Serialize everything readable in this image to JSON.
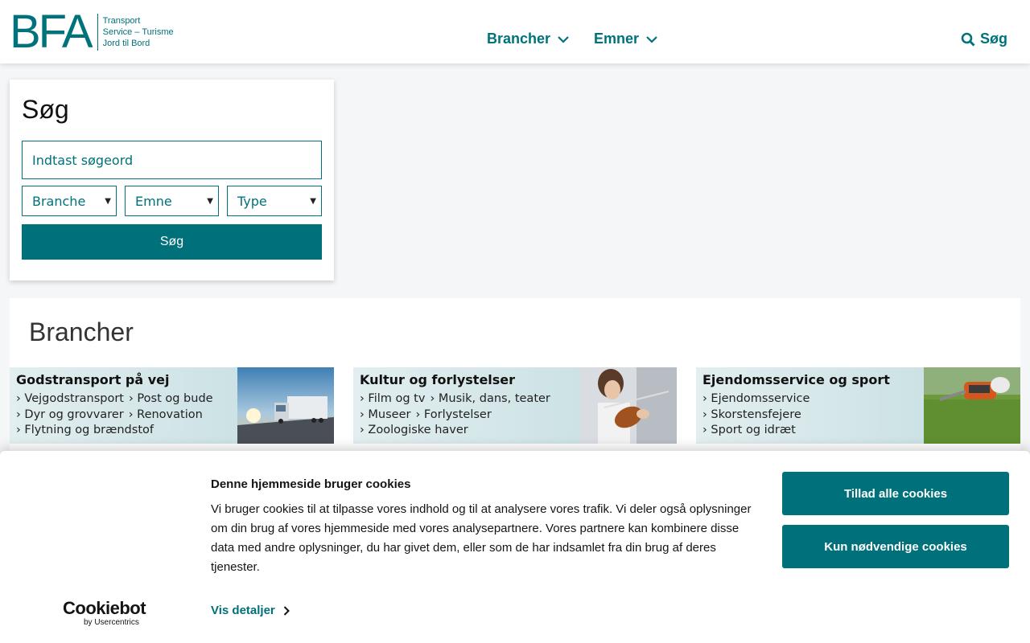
{
  "header": {
    "logo": {
      "mark": "BFA",
      "lines": [
        "Transport",
        "Service – Turisme",
        "Jord til Bord"
      ]
    },
    "nav": [
      {
        "label": "Brancher"
      },
      {
        "label": "Emner"
      }
    ],
    "search_label": "Søg"
  },
  "search_panel": {
    "title": "Søg",
    "input_placeholder": "Indtast søgeord",
    "filters": [
      {
        "label": "Branche"
      },
      {
        "label": "Emne"
      },
      {
        "label": "Type"
      }
    ],
    "button_label": "Søg"
  },
  "brancher": {
    "title": "Brancher",
    "cards": [
      {
        "title": "Godstransport på vej",
        "rows": [
          [
            "Vejgodstransport",
            "Post og bude"
          ],
          [
            "Dyr og grovvarer",
            "Renovation"
          ],
          [
            "Flytning og brændstof"
          ]
        ]
      },
      {
        "title": "Kultur og forlystelser",
        "rows": [
          [
            "Film og tv",
            "Musik, dans, teater"
          ],
          [
            "Museer",
            "Forlystelser"
          ],
          [
            "Zoologiske haver"
          ]
        ]
      },
      {
        "title": "Ejendomsservice og sport",
        "rows": [
          [
            "Ejendomsservice"
          ],
          [
            "Skorstensfejere"
          ],
          [
            "Sport og idræt"
          ]
        ]
      }
    ]
  },
  "cookie_banner": {
    "title": "Denne hjemmeside bruger cookies",
    "text": "Vi bruger cookies til at tilpasse vores indhold og til at analysere vores trafik. Vi deler også oplysninger om din brug af vores hjemmeside med vores analysepartnere. Vores partnere kan kombinere disse data med andre oplysninger, du har givet dem, eller som de har indsamlet fra din brug af deres tjenester.",
    "details_label": "Vis detaljer",
    "allow_all_label": "Tillad alle cookies",
    "necessary_label": "Kun nødvendige cookies",
    "brand": {
      "name": "Cookiebot",
      "sub": "by Usercentrics"
    }
  },
  "colors": {
    "brand": "#00727b",
    "button": "#00707a"
  }
}
